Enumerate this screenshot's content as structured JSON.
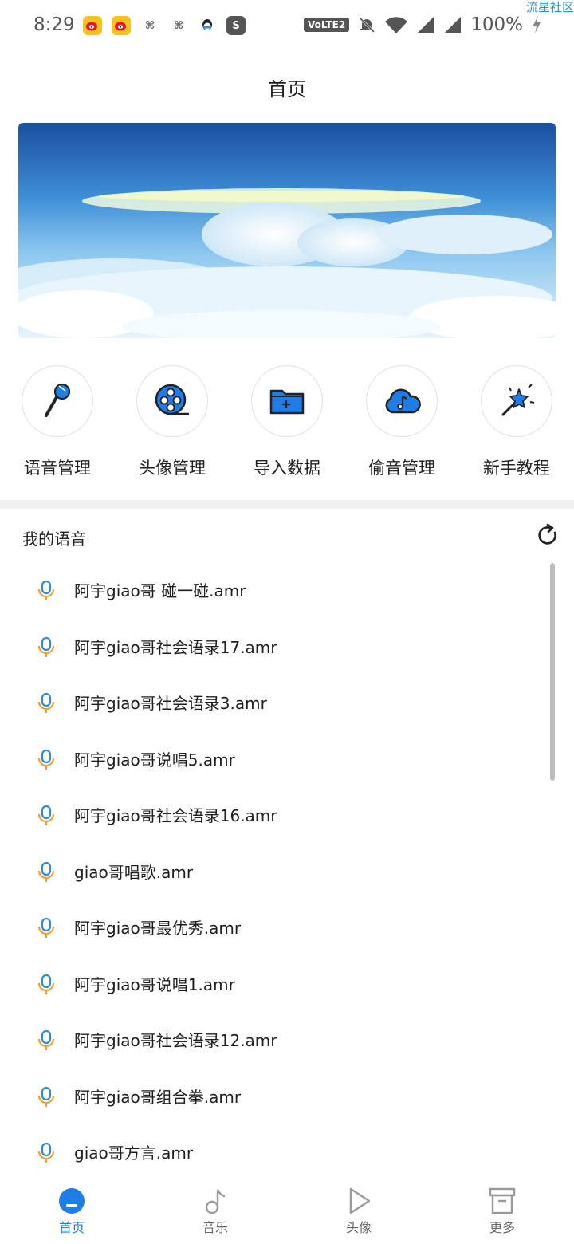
{
  "status_bar": {
    "time": "8:29",
    "app_icons": [
      "weibo-icon",
      "weibo-icon",
      "app-icon",
      "app-icon",
      "qq-icon",
      "sogou-icon"
    ],
    "network_badge": "VoLTE2",
    "battery": "100%",
    "watermark": "流星社区"
  },
  "header": {
    "title": "首页"
  },
  "banner": {
    "alt": "sky-clouds-banner"
  },
  "quick_actions": [
    {
      "label": "语音管理",
      "icon": "microphone-icon"
    },
    {
      "label": "头像管理",
      "icon": "film-reel-icon"
    },
    {
      "label": "导入数据",
      "icon": "folder-add-icon"
    },
    {
      "label": "偷音管理",
      "icon": "cloud-music-icon"
    },
    {
      "label": "新手教程",
      "icon": "magic-wand-icon"
    }
  ],
  "voice_section": {
    "title": "我的语音",
    "items": [
      "阿宇giao哥 碰一碰.amr",
      "阿宇giao哥社会语录17.amr",
      "阿宇giao哥社会语录3.amr",
      "阿宇giao哥说唱5.amr",
      "阿宇giao哥社会语录16.amr",
      "giao哥唱歌.amr",
      "阿宇giao哥最优秀.amr",
      "阿宇giao哥说唱1.amr",
      "阿宇giao哥社会语录12.amr",
      "阿宇giao哥组合拳.amr",
      "giao哥方言.amr"
    ]
  },
  "bottom_nav": [
    {
      "label": "首页",
      "icon": "home-icon",
      "active": true
    },
    {
      "label": "音乐",
      "icon": "music-note-icon",
      "active": false
    },
    {
      "label": "头像",
      "icon": "play-icon",
      "active": false
    },
    {
      "label": "更多",
      "icon": "box-icon",
      "active": false
    }
  ],
  "colors": {
    "accent": "#1f7de6",
    "mic_blue": "#2f8ccf",
    "mic_orange": "#f0a030"
  }
}
